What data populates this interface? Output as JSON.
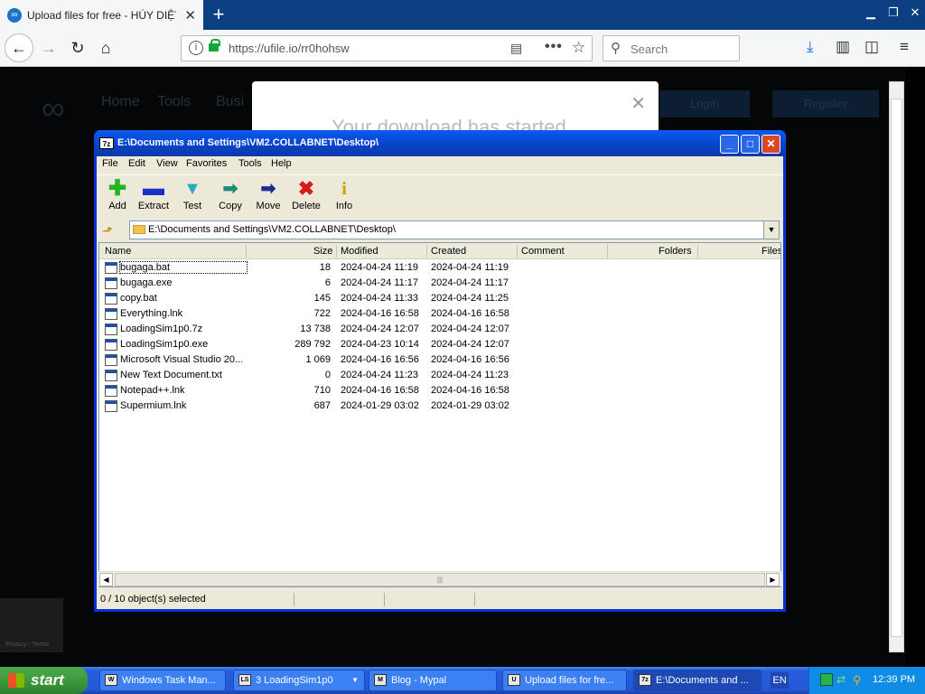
{
  "browser": {
    "tab_title": "Upload files for free - HÚY DIỆT M",
    "url": "https://ufile.io/rr0hohsw",
    "search_placeholder": "Search"
  },
  "website": {
    "nav": [
      "Home",
      "Tools",
      "Busi"
    ],
    "login": "Login",
    "register": "Register",
    "modal_message": "Your download has started"
  },
  "zip": {
    "title": "E:\\Documents and Settings\\VM2.COLLABNET\\Desktop\\",
    "menu": [
      "File",
      "Edit",
      "View",
      "Favorites",
      "Tools",
      "Help"
    ],
    "tools": [
      {
        "label": "Add",
        "icon": "plus-icon",
        "color": "#22b422"
      },
      {
        "label": "Extract",
        "icon": "minus-icon",
        "color": "#1b2fc4"
      },
      {
        "label": "Test",
        "icon": "check-icon",
        "color": "#2aa8c8"
      },
      {
        "label": "Copy",
        "icon": "copy-arrow-icon",
        "color": "#1c8a7a"
      },
      {
        "label": "Move",
        "icon": "move-arrow-icon",
        "color": "#1b2a8c"
      },
      {
        "label": "Delete",
        "icon": "delete-x-icon",
        "color": "#d61a1a"
      },
      {
        "label": "Info",
        "icon": "info-icon",
        "color": "#c8a000"
      }
    ],
    "path": "E:\\Documents and Settings\\VM2.COLLABNET\\Desktop\\",
    "columns": [
      "Name",
      "Size",
      "Modified",
      "Created",
      "Comment",
      "Folders",
      "Files"
    ],
    "files": [
      {
        "name": "bugaga.bat",
        "size": "18",
        "modified": "2024-04-24 11:19",
        "created": "2024-04-24 11:19"
      },
      {
        "name": "bugaga.exe",
        "size": "6",
        "modified": "2024-04-24 11:17",
        "created": "2024-04-24 11:17"
      },
      {
        "name": "copy.bat",
        "size": "145",
        "modified": "2024-04-24 11:33",
        "created": "2024-04-24 11:25"
      },
      {
        "name": "Everything.lnk",
        "size": "722",
        "modified": "2024-04-16 16:58",
        "created": "2024-04-16 16:58"
      },
      {
        "name": "LoadingSim1p0.7z",
        "size": "13 738",
        "modified": "2024-04-24 12:07",
        "created": "2024-04-24 12:07"
      },
      {
        "name": "LoadingSim1p0.exe",
        "size": "289 792",
        "modified": "2024-04-23 10:14",
        "created": "2024-04-24 12:07"
      },
      {
        "name": "Microsoft Visual Studio 20...",
        "size": "1 069",
        "modified": "2024-04-16 16:56",
        "created": "2024-04-16 16:56"
      },
      {
        "name": "New Text Document.txt",
        "size": "0",
        "modified": "2024-04-24 11:23",
        "created": "2024-04-24 11:23"
      },
      {
        "name": "Notepad++.lnk",
        "size": "710",
        "modified": "2024-04-16 16:58",
        "created": "2024-04-16 16:58"
      },
      {
        "name": "Supermium.lnk",
        "size": "687",
        "modified": "2024-01-29 03:02",
        "created": "2024-01-29 03:02"
      }
    ],
    "status": "0 / 10 object(s) selected"
  },
  "taskbar": {
    "start": "start",
    "tasks": [
      {
        "label": "Windows Task Man...",
        "icon": "W"
      },
      {
        "label": "3 LoadingSim1p0",
        "icon": "LS"
      },
      {
        "label": "Blog - Mypal",
        "icon": "M"
      },
      {
        "label": "Upload files for fre...",
        "icon": "U"
      },
      {
        "label": "E:\\Documents and ...",
        "icon": "7z"
      }
    ],
    "lang": "EN",
    "clock": "12:39 PM"
  },
  "colors": {
    "xp_blue": "#0a5bf0",
    "start_green": "#3c9b3c",
    "lock_green": "#14a53b"
  }
}
